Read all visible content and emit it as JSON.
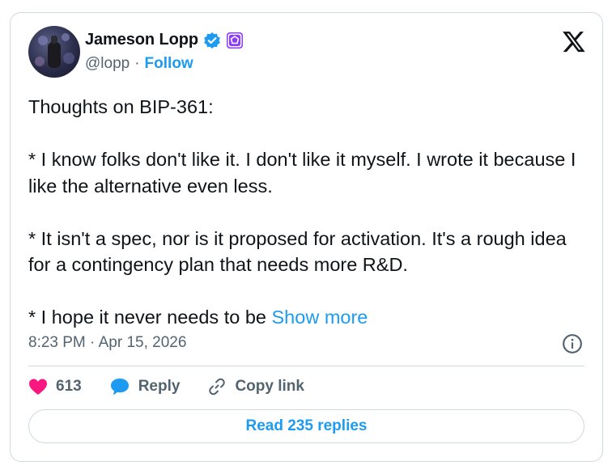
{
  "author": {
    "name": "Jameson Lopp",
    "handle": "@lopp",
    "separator": "·",
    "follow_label": "Follow",
    "verified_badge_color": "#1d9bf0",
    "affiliate_badge_color": "#8b3dff"
  },
  "tweet": {
    "text": "Thoughts on BIP-361:\n\n* I know folks don't like it. I don't like it myself. I wrote it because I like the alternative even less.\n\n* It isn't a spec, nor is it proposed for activation. It's a rough idea for a contingency plan that needs more R&D.\n\n* I hope it never needs to be ",
    "show_more_label": "Show more",
    "timestamp": "8:23 PM · Apr 15, 2026"
  },
  "actions": {
    "like_count": "613",
    "reply_label": "Reply",
    "copy_link_label": "Copy link",
    "like_color": "#f91880",
    "reply_icon_color": "#1d9bf0"
  },
  "read_replies_label": "Read 235 replies",
  "icons": [
    "x-logo-icon",
    "verified-badge-icon",
    "affiliate-badge-icon",
    "info-icon",
    "heart-icon",
    "reply-bubble-icon",
    "link-icon"
  ]
}
